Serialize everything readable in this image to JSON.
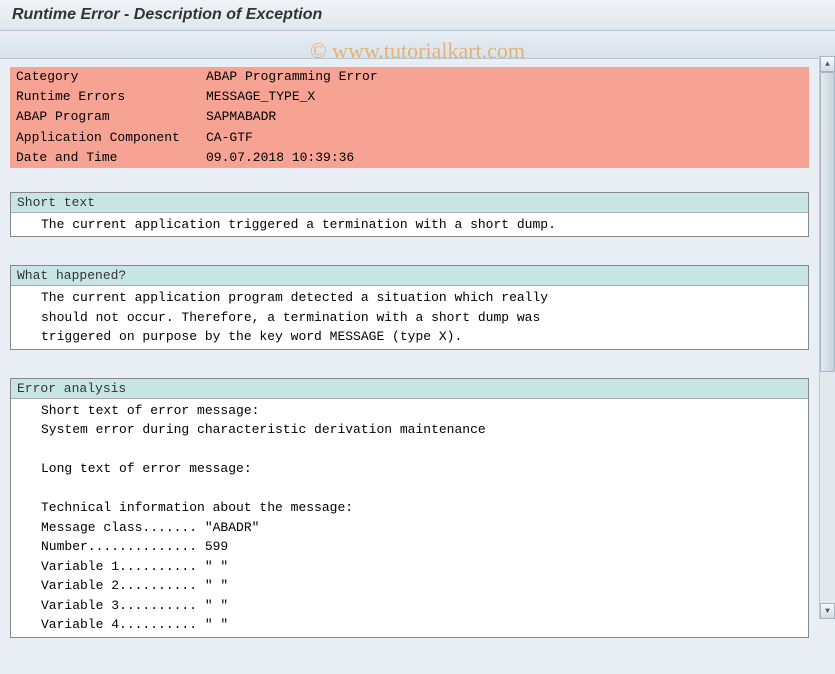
{
  "title": "Runtime Error - Description of Exception",
  "watermark": "© www.tutorialkart.com",
  "info": {
    "category_label": "Category",
    "category_value": "ABAP Programming Error",
    "runtime_label": "Runtime Errors",
    "runtime_value": "MESSAGE_TYPE_X",
    "program_label": "ABAP Program",
    "program_value": "SAPMABADR",
    "component_label": "Application Component",
    "component_value": "CA-GTF",
    "datetime_label": "Date and Time",
    "datetime_value": "09.07.2018 10:39:36"
  },
  "sections": {
    "short_text": {
      "header": "Short text",
      "body": "The current application triggered a termination with a short dump."
    },
    "what_happened": {
      "header": "What happened?",
      "body": "The current application program detected a situation which really\nshould not occur. Therefore, a termination with a short dump was\ntriggered on purpose by the key word MESSAGE (type X)."
    },
    "error_analysis": {
      "header": "Error analysis",
      "body": "Short text of error message:\nSystem error during characteristic derivation maintenance\n\nLong text of error message:\n\nTechnical information about the message:\nMessage class....... \"ABADR\"\nNumber.............. 599\nVariable 1.......... \" \"\nVariable 2.......... \" \"\nVariable 3.......... \" \"\nVariable 4.......... \" \""
    }
  }
}
